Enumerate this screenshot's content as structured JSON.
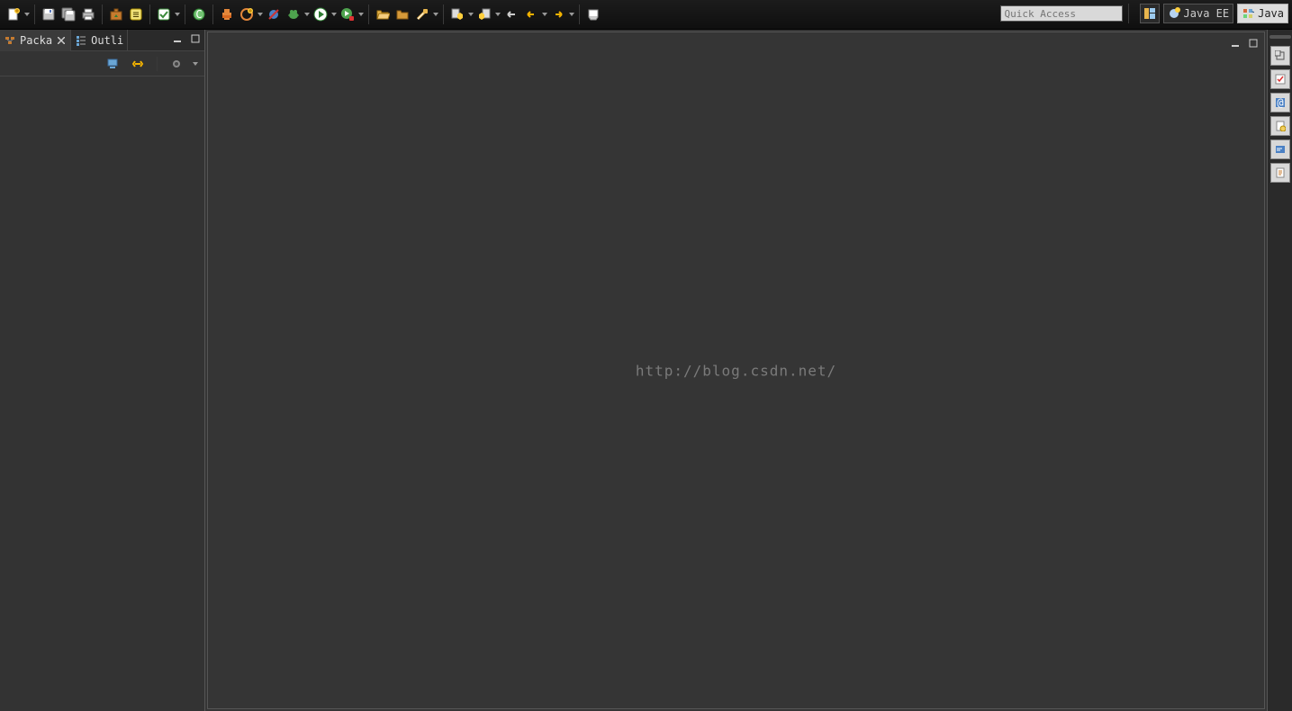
{
  "quick_access_placeholder": "Quick Access",
  "perspectives": {
    "java_ee": "Java EE",
    "java": "Java"
  },
  "views": {
    "package_explorer": "Packa",
    "outline": "Outli"
  },
  "watermark": "http://blog.csdn.net/",
  "toolbar_icons": [
    "new-wizard",
    "save",
    "save-all",
    "print",
    "build",
    "open-type",
    "create-task",
    "new-java-class",
    "debug",
    "run-config",
    "skip-breakpoints",
    "debug-run",
    "run",
    "external-tools",
    "open-project",
    "open-folder",
    "highlight",
    "next-annotation",
    "prev-annotation",
    "last-edit",
    "back",
    "forward",
    "pin-editor"
  ],
  "trim_icons": [
    "tasks-view",
    "markers-view",
    "javadoc-view",
    "declaration-view",
    "console-view",
    "palette-view"
  ]
}
